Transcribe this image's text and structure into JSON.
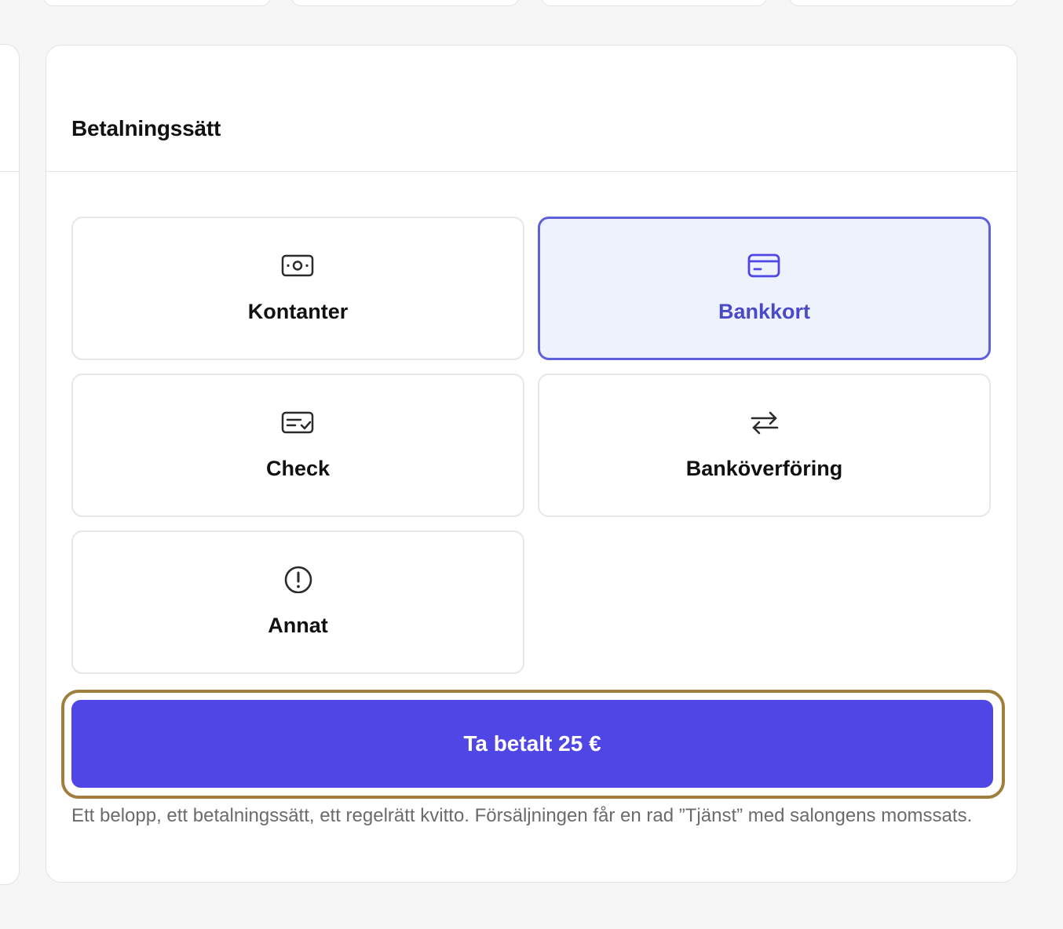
{
  "panel": {
    "title": "Betalningssätt"
  },
  "methods": [
    {
      "label": "Kontanter",
      "icon": "cash-icon",
      "selected": false
    },
    {
      "label": "Bankkort",
      "icon": "credit-card-icon",
      "selected": true
    },
    {
      "label": "Check",
      "icon": "check-icon",
      "selected": false
    },
    {
      "label": "Banköverföring",
      "icon": "transfer-arrows-icon",
      "selected": false
    },
    {
      "label": "Annat",
      "icon": "alert-circle-icon",
      "selected": false
    }
  ],
  "pay_button": {
    "label": "Ta betalt 25 €"
  },
  "note": "Ett belopp, ett betalningssätt, ett regelrätt kvitto. Försäljningen får en rad ”Tjänst” med salongens momssats.",
  "colors": {
    "accent": "#4f46e5",
    "selected_border": "#5f61dc",
    "selected_background": "#eef2fd",
    "selected_text": "#4b49c8",
    "focus_ring": "#a07f3e",
    "page_background": "#f6f6f6"
  }
}
